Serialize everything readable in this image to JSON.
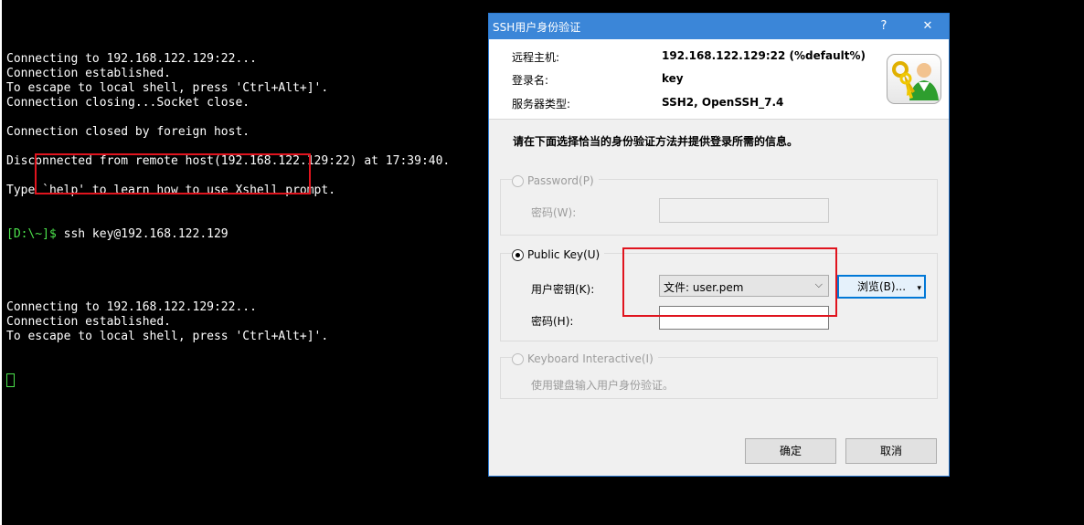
{
  "terminal": {
    "lines": [
      "Connecting to 192.168.122.129:22...",
      "Connection established.",
      "To escape to local shell, press 'Ctrl+Alt+]'.",
      "Connection closing...Socket close.",
      "",
      "Connection closed by foreign host.",
      "",
      "Disconnected from remote host(192.168.122.129:22) at 17:39:40.",
      "",
      "Type `help' to learn how to use Xshell prompt."
    ],
    "prompt": "[D:\\~]$",
    "command": " ssh key@192.168.122.129",
    "lines_after": [
      "",
      "",
      "Connecting to 192.168.122.129:22...",
      "Connection established.",
      "To escape to local shell, press 'Ctrl+Alt+]'."
    ],
    "prompt_color": "#4ce34c"
  },
  "dialog": {
    "title": "SSH用户身份验证",
    "help_label": "?",
    "close_label": "✕",
    "remote_host_label": "远程主机:",
    "remote_host_value": "192.168.122.129:22 (%default%)",
    "login_label": "登录名:",
    "login_value": "key",
    "server_type_label": "服务器类型:",
    "server_type_value": "SSH2, OpenSSH_7.4",
    "instruction": "请在下面选择恰当的身份验证方法并提供登录所需的信息。",
    "password_option": "Password(P)",
    "password_field_label": "密码(W):",
    "public_key_option": "Public Key(U)",
    "user_key_label": "用户密钥(K):",
    "user_key_value": "文件: user.pem",
    "browse_label": "浏览(B)...",
    "passphrase_label": "密码(H):",
    "keyboard_option": "Keyboard Interactive(I)",
    "keyboard_desc": "使用键盘输入用户身份验证。",
    "ok_label": "确定",
    "cancel_label": "取消",
    "accent_color": "#3b86d8"
  }
}
